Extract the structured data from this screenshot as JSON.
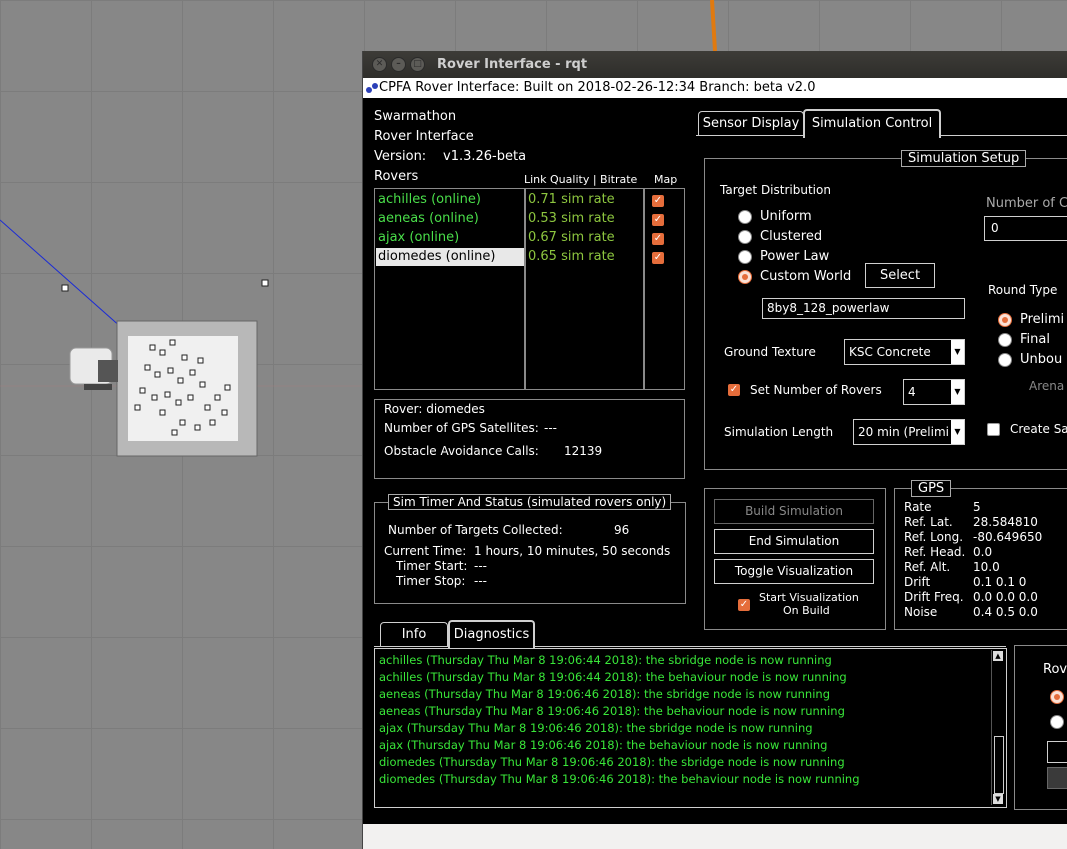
{
  "window": {
    "title": "Rover Interface - rqt"
  },
  "menubar": {
    "text": "CPFA Rover Interface: Built on 2018-02-26-12:34 Branch: beta  v2.0"
  },
  "info": {
    "line1": "Swarmathon",
    "line2": "Rover Interface",
    "version_label": "Version:",
    "version_value": "v1.3.26-beta"
  },
  "rovers": {
    "header": "Rovers",
    "link_header": "Link Quality | Bitrate",
    "map_header": "Map",
    "items": [
      {
        "name": "achilles (online)",
        "rate": "0.71 sim rate"
      },
      {
        "name": "aeneas (online)",
        "rate": "0.53 sim rate"
      },
      {
        "name": "ajax (online)",
        "rate": "0.67 sim rate"
      },
      {
        "name": "diomedes (online)",
        "rate": "0.65 sim rate"
      }
    ]
  },
  "rover_status": {
    "rover": "Rover: diomedes",
    "gps_label": "Number of GPS Satellites:",
    "gps_value": "---",
    "obstacle_label": "Obstacle Avoidance Calls:",
    "obstacle_value": "12139"
  },
  "sim_timer": {
    "title": "Sim Timer And Status (simulated rovers only)",
    "targets_label": "Number of Targets Collected:",
    "targets_value": "96",
    "current_label": "Current Time:",
    "current_value": "1 hours, 10 minutes, 50 seconds",
    "start_label": "Timer Start:",
    "start_value": "---",
    "stop_label": "Timer Stop:",
    "stop_value": "---"
  },
  "tabs": {
    "sensor": "Sensor Display",
    "sim": "Simulation Control",
    "info": "Info",
    "diag": "Diagnostics"
  },
  "sim_setup": {
    "title": "Simulation Setup",
    "target_dist": "Target Distribution",
    "options": [
      "Uniform",
      "Clustered",
      "Power Law",
      "Custom World"
    ],
    "select": "Select",
    "world_file": "8by8_128_powerlaw",
    "ground_label": "Ground Texture",
    "ground_value": "KSC Concrete",
    "set_rovers_label": "Set Number of Rovers",
    "rovers_value": "4",
    "length_label": "Simulation Length",
    "length_value": "20 min (Prelimi",
    "num_label": "Number of C",
    "num_value": "0",
    "round_type": "Round Type",
    "round_options": [
      "Prelimi",
      "Final",
      "Unbou"
    ],
    "arena": "Arena",
    "create_save": "Create Sav"
  },
  "controls": {
    "build": "Build Simulation",
    "end": "End Simulation",
    "toggle": "Toggle Visualization",
    "start_vis_1": "Start Visualization",
    "start_vis_2": "On Build"
  },
  "gps": {
    "title": "GPS",
    "rows": [
      {
        "k": "Rate",
        "v": "5"
      },
      {
        "k": "Ref. Lat.",
        "v": "28.584810"
      },
      {
        "k": "Ref. Long.",
        "v": "-80.649650"
      },
      {
        "k": "Ref. Head.",
        "v": "0.0"
      },
      {
        "k": "Ref. Alt.",
        "v": "10.0"
      },
      {
        "k": "Drift",
        "v": "0.1 0.1 0"
      },
      {
        "k": "Drift Freq.",
        "v": "0.0 0.0 0.0"
      },
      {
        "k": "Noise",
        "v": "0.4 0.5 0.0"
      }
    ]
  },
  "log": [
    "achilles (Thursday Thu Mar 8 19:06:44 2018): the sbridge node is now running",
    "achilles (Thursday Thu Mar 8 19:06:44 2018): the behaviour node is now running",
    "aeneas (Thursday Thu Mar 8 19:06:46 2018): the sbridge node is now running",
    "aeneas (Thursday Thu Mar 8 19:06:46 2018): the behaviour node is now running",
    "ajax (Thursday Thu Mar 8 19:06:46 2018): the sbridge node is now running",
    "ajax (Thursday Thu Mar 8 19:06:46 2018): the behaviour node is now running",
    "diomedes (Thursday Thu Mar 8 19:06:46 2018): the sbridge node is now running",
    "diomedes (Thursday Thu Mar 8 19:06:46 2018): the behaviour node is now running"
  ],
  "right_panel": {
    "label": "Rov"
  }
}
